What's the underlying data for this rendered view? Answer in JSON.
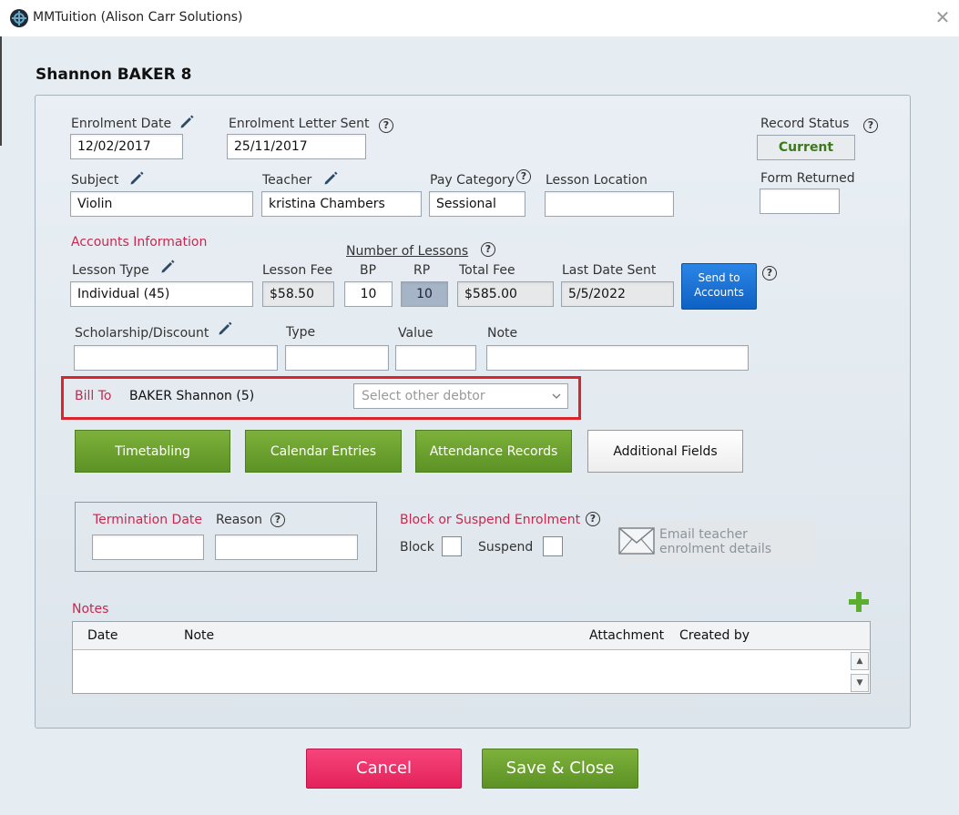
{
  "window": {
    "title": "MMTuition (Alison Carr Solutions)",
    "close_label": "✕"
  },
  "student": {
    "name": "Shannon BAKER 8"
  },
  "enrolment": {
    "enrolment_date_label": "Enrolment Date",
    "enrolment_date": "12/02/2017",
    "letter_sent_label": "Enrolment Letter Sent",
    "letter_sent": "25/11/2017",
    "record_status_label": "Record Status",
    "record_status": "Current",
    "form_returned_label": "Form Returned",
    "form_returned": "",
    "subject_label": "Subject",
    "subject": "Violin",
    "teacher_label": "Teacher",
    "teacher": "kristina Chambers",
    "pay_category_label": "Pay Category",
    "pay_category": "Sessional",
    "lesson_location_label": "Lesson Location",
    "lesson_location": ""
  },
  "accounts": {
    "section_label": "Accounts Information",
    "number_of_lessons_label": "Number of Lessons",
    "lesson_type_label": "Lesson Type",
    "lesson_type": "Individual (45)",
    "lesson_fee_label": "Lesson Fee",
    "lesson_fee": "$58.50",
    "bp_label": "BP",
    "bp": "10",
    "rp_label": "RP",
    "rp": "10",
    "total_fee_label": "Total Fee",
    "total_fee": "$585.00",
    "last_date_sent_label": "Last Date Sent",
    "last_date_sent": "5/5/2022",
    "send_button": "Send to Accounts"
  },
  "scholarship": {
    "label": "Scholarship/Discount",
    "type_label": "Type",
    "value_label": "Value",
    "note_label": "Note"
  },
  "bill_to": {
    "label": "Bill To",
    "debtor": "BAKER Shannon (5)",
    "select_placeholder": "Select other debtor"
  },
  "actions": {
    "timetabling": "Timetabling",
    "calendar": "Calendar Entries",
    "attendance": "Attendance Records",
    "additional": "Additional Fields"
  },
  "termination": {
    "date_label": "Termination Date",
    "reason_label": "Reason"
  },
  "block": {
    "label": "Block or Suspend Enrolment",
    "block_label": "Block",
    "suspend_label": "Suspend"
  },
  "email_teacher": {
    "label": "Email teacher enrolment details"
  },
  "notes": {
    "label": "Notes",
    "columns": [
      "Date",
      "Note",
      "Attachment",
      "Created by"
    ]
  },
  "footer": {
    "cancel": "Cancel",
    "save_close": "Save & Close"
  },
  "colors": {
    "accent_red": "#c8284f",
    "green": "#5c9225",
    "blue": "#1a72d8",
    "pink": "#e4215b"
  }
}
